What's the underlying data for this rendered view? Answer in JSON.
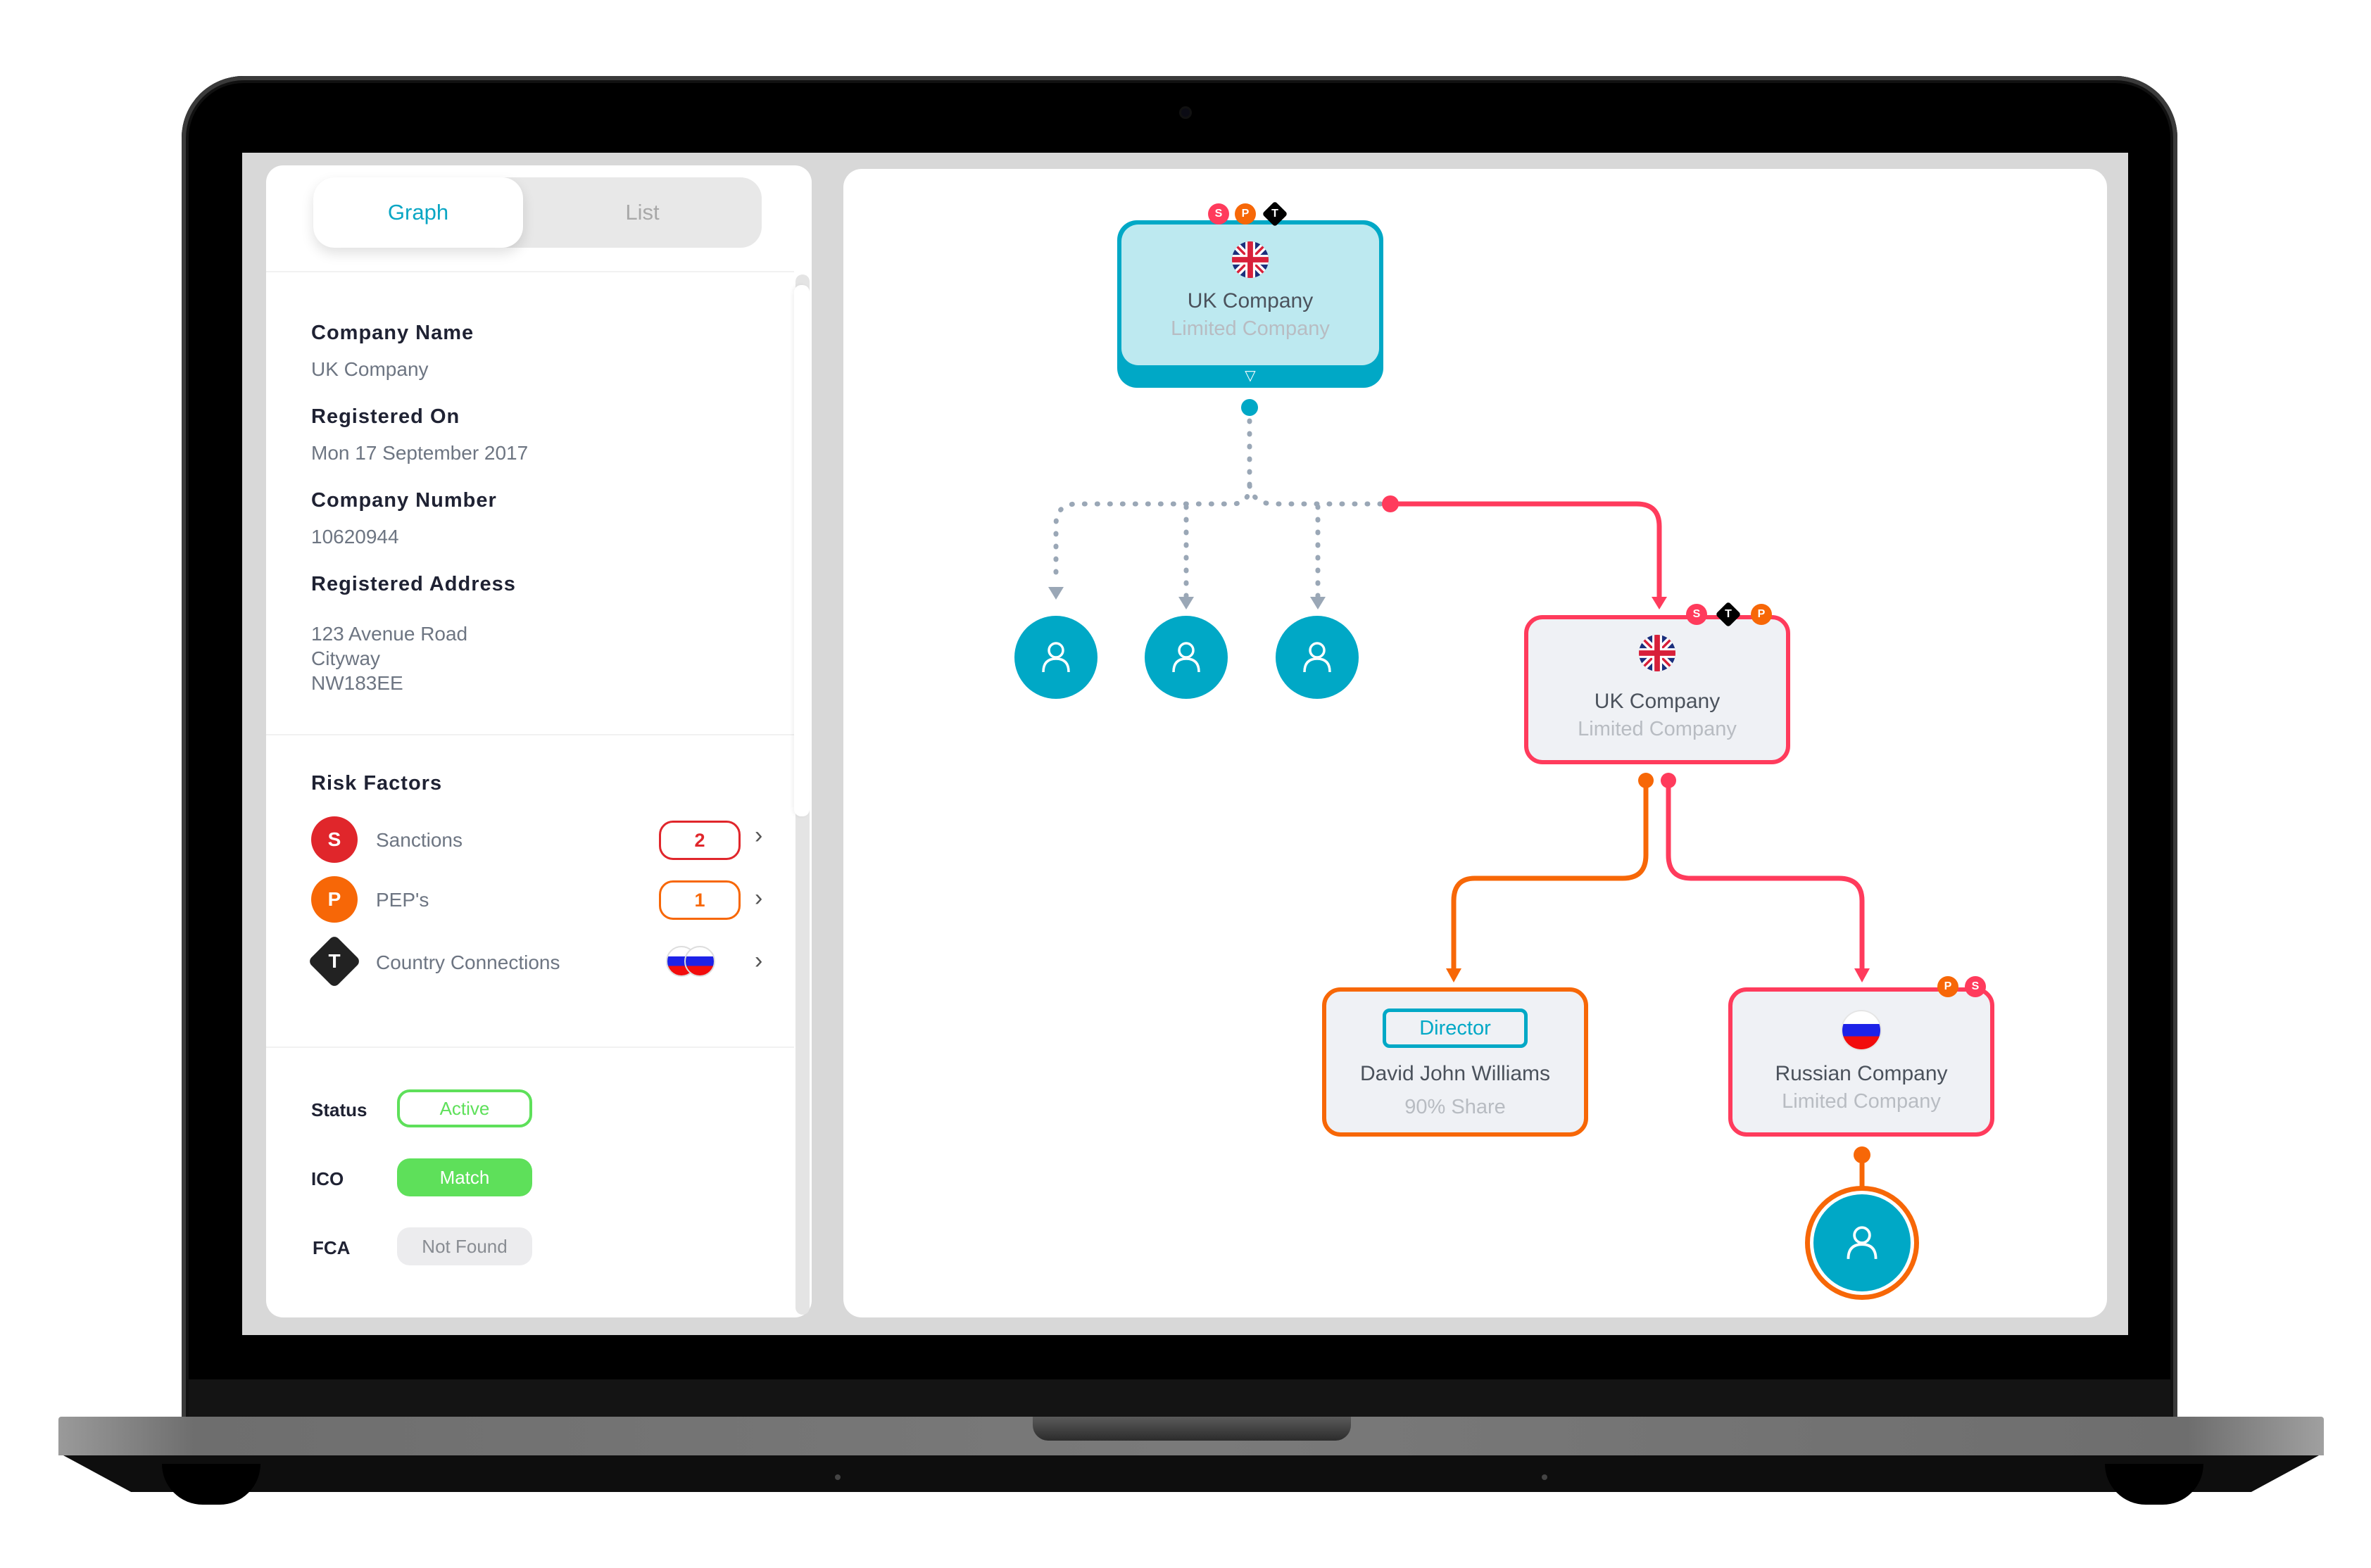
{
  "tabs": [
    {
      "label": "Graph",
      "active": true
    },
    {
      "label": "List",
      "active": false
    }
  ],
  "details": {
    "company_name_label": "Company Name",
    "company_name": "UK Company",
    "registered_on_label": "Registered On",
    "registered_on": "Mon 17 September 2017",
    "company_number_label": "Company Number",
    "company_number": "10620944",
    "registered_address_label": "Registered Address",
    "address_lines": [
      "123 Avenue Road",
      "Cityway",
      "NW183EE"
    ]
  },
  "risk_factors": {
    "title": "Risk Factors",
    "items": [
      {
        "icon": "S",
        "label": "Sanctions",
        "count": "2",
        "color": "#e0262b"
      },
      {
        "icon": "P",
        "label": "PEP's",
        "count": "1",
        "color": "#f76707"
      },
      {
        "icon": "T",
        "label": "Country Connections",
        "flags": [
          "russia-flag",
          "russia-flag"
        ],
        "color": "#222222"
      }
    ]
  },
  "checks": [
    {
      "label": "Status",
      "value": "Active",
      "style": "outline-green"
    },
    {
      "label": "ICO",
      "value": "Match",
      "style": "filled-green"
    },
    {
      "label": "FCA",
      "value": "Not Found",
      "style": "gray"
    }
  ],
  "graph": {
    "root": {
      "title": "UK Company",
      "subtitle": "Limited Company",
      "flag": "uk-flag",
      "badges": [
        "S",
        "P",
        "T"
      ]
    },
    "persons_top": [
      {
        "icon": "person-icon"
      },
      {
        "icon": "person-icon"
      },
      {
        "icon": "person-icon"
      }
    ],
    "child_company": {
      "title": "UK Company",
      "subtitle": "Limited Company",
      "flag": "uk-flag",
      "badges": [
        "S",
        "T",
        "P"
      ]
    },
    "director": {
      "role": "Director",
      "name": "David John Williams",
      "share": "90% Share"
    },
    "russian_company": {
      "title": "Russian Company",
      "subtitle": "Limited Company",
      "flag": "russia-flag",
      "badges": [
        "P",
        "S"
      ]
    },
    "bottom_person": {
      "icon": "person-icon"
    }
  },
  "colors": {
    "accent": "#00a8c6",
    "sanction": "#ff3b5c",
    "pep": "#f76707",
    "active_green": "#5ee05a",
    "connector_gray": "#9aa7b6"
  }
}
